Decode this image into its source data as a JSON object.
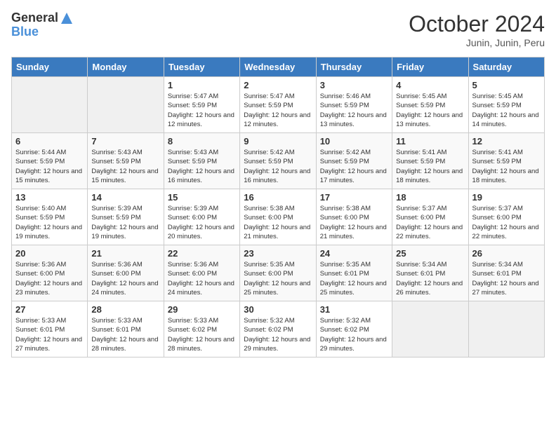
{
  "header": {
    "logo_general": "General",
    "logo_blue": "Blue",
    "month_title": "October 2024",
    "subtitle": "Junin, Junin, Peru"
  },
  "days_of_week": [
    "Sunday",
    "Monday",
    "Tuesday",
    "Wednesday",
    "Thursday",
    "Friday",
    "Saturday"
  ],
  "weeks": [
    [
      {
        "num": "",
        "empty": true
      },
      {
        "num": "",
        "empty": true
      },
      {
        "num": "1",
        "sunrise": "5:47 AM",
        "sunset": "5:59 PM",
        "daylight": "12 hours and 12 minutes."
      },
      {
        "num": "2",
        "sunrise": "5:47 AM",
        "sunset": "5:59 PM",
        "daylight": "12 hours and 12 minutes."
      },
      {
        "num": "3",
        "sunrise": "5:46 AM",
        "sunset": "5:59 PM",
        "daylight": "12 hours and 13 minutes."
      },
      {
        "num": "4",
        "sunrise": "5:45 AM",
        "sunset": "5:59 PM",
        "daylight": "12 hours and 13 minutes."
      },
      {
        "num": "5",
        "sunrise": "5:45 AM",
        "sunset": "5:59 PM",
        "daylight": "12 hours and 14 minutes."
      }
    ],
    [
      {
        "num": "6",
        "sunrise": "5:44 AM",
        "sunset": "5:59 PM",
        "daylight": "12 hours and 15 minutes."
      },
      {
        "num": "7",
        "sunrise": "5:43 AM",
        "sunset": "5:59 PM",
        "daylight": "12 hours and 15 minutes."
      },
      {
        "num": "8",
        "sunrise": "5:43 AM",
        "sunset": "5:59 PM",
        "daylight": "12 hours and 16 minutes."
      },
      {
        "num": "9",
        "sunrise": "5:42 AM",
        "sunset": "5:59 PM",
        "daylight": "12 hours and 16 minutes."
      },
      {
        "num": "10",
        "sunrise": "5:42 AM",
        "sunset": "5:59 PM",
        "daylight": "12 hours and 17 minutes."
      },
      {
        "num": "11",
        "sunrise": "5:41 AM",
        "sunset": "5:59 PM",
        "daylight": "12 hours and 18 minutes."
      },
      {
        "num": "12",
        "sunrise": "5:41 AM",
        "sunset": "5:59 PM",
        "daylight": "12 hours and 18 minutes."
      }
    ],
    [
      {
        "num": "13",
        "sunrise": "5:40 AM",
        "sunset": "5:59 PM",
        "daylight": "12 hours and 19 minutes."
      },
      {
        "num": "14",
        "sunrise": "5:39 AM",
        "sunset": "5:59 PM",
        "daylight": "12 hours and 19 minutes."
      },
      {
        "num": "15",
        "sunrise": "5:39 AM",
        "sunset": "6:00 PM",
        "daylight": "12 hours and 20 minutes."
      },
      {
        "num": "16",
        "sunrise": "5:38 AM",
        "sunset": "6:00 PM",
        "daylight": "12 hours and 21 minutes."
      },
      {
        "num": "17",
        "sunrise": "5:38 AM",
        "sunset": "6:00 PM",
        "daylight": "12 hours and 21 minutes."
      },
      {
        "num": "18",
        "sunrise": "5:37 AM",
        "sunset": "6:00 PM",
        "daylight": "12 hours and 22 minutes."
      },
      {
        "num": "19",
        "sunrise": "5:37 AM",
        "sunset": "6:00 PM",
        "daylight": "12 hours and 22 minutes."
      }
    ],
    [
      {
        "num": "20",
        "sunrise": "5:36 AM",
        "sunset": "6:00 PM",
        "daylight": "12 hours and 23 minutes."
      },
      {
        "num": "21",
        "sunrise": "5:36 AM",
        "sunset": "6:00 PM",
        "daylight": "12 hours and 24 minutes."
      },
      {
        "num": "22",
        "sunrise": "5:36 AM",
        "sunset": "6:00 PM",
        "daylight": "12 hours and 24 minutes."
      },
      {
        "num": "23",
        "sunrise": "5:35 AM",
        "sunset": "6:00 PM",
        "daylight": "12 hours and 25 minutes."
      },
      {
        "num": "24",
        "sunrise": "5:35 AM",
        "sunset": "6:01 PM",
        "daylight": "12 hours and 25 minutes."
      },
      {
        "num": "25",
        "sunrise": "5:34 AM",
        "sunset": "6:01 PM",
        "daylight": "12 hours and 26 minutes."
      },
      {
        "num": "26",
        "sunrise": "5:34 AM",
        "sunset": "6:01 PM",
        "daylight": "12 hours and 27 minutes."
      }
    ],
    [
      {
        "num": "27",
        "sunrise": "5:33 AM",
        "sunset": "6:01 PM",
        "daylight": "12 hours and 27 minutes."
      },
      {
        "num": "28",
        "sunrise": "5:33 AM",
        "sunset": "6:01 PM",
        "daylight": "12 hours and 28 minutes."
      },
      {
        "num": "29",
        "sunrise": "5:33 AM",
        "sunset": "6:02 PM",
        "daylight": "12 hours and 28 minutes."
      },
      {
        "num": "30",
        "sunrise": "5:32 AM",
        "sunset": "6:02 PM",
        "daylight": "12 hours and 29 minutes."
      },
      {
        "num": "31",
        "sunrise": "5:32 AM",
        "sunset": "6:02 PM",
        "daylight": "12 hours and 29 minutes."
      },
      {
        "num": "",
        "empty": true
      },
      {
        "num": "",
        "empty": true
      }
    ]
  ]
}
